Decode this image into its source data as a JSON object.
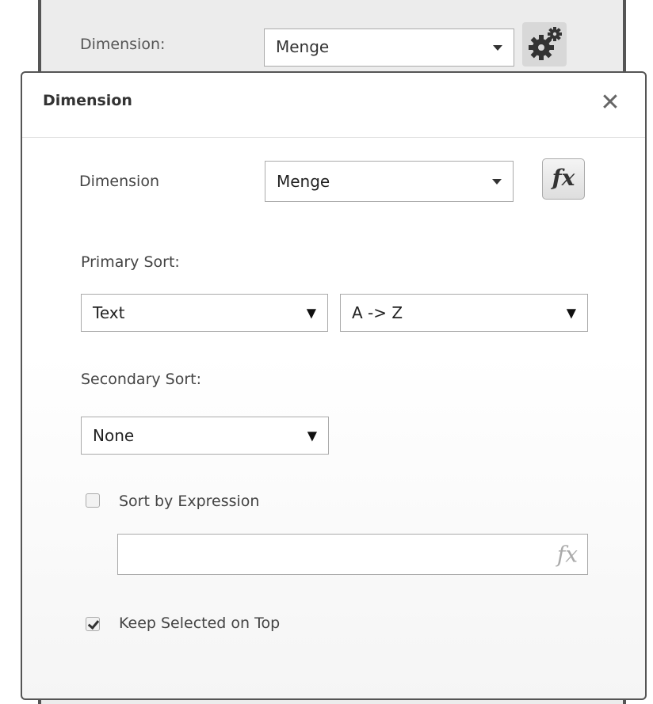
{
  "background": {
    "dimension_label": "Dimension:",
    "dimension_value": "Menge"
  },
  "dialog": {
    "title": "Dimension",
    "close_glyph": "✕",
    "dimension_label": "Dimension",
    "dimension_value": "Menge",
    "fx_label": "fx",
    "primary_sort_label": "Primary Sort:",
    "primary_sort_type": "Text",
    "primary_sort_order": "A -> Z",
    "secondary_sort_label": "Secondary Sort:",
    "secondary_sort_type": "None",
    "sort_by_expression_label": "Sort by Expression",
    "sort_by_expression_checked": false,
    "expression_fx": "fx",
    "keep_selected_label": "Keep Selected on Top",
    "keep_selected_checked": true
  },
  "dropdown_arrow": "▼"
}
